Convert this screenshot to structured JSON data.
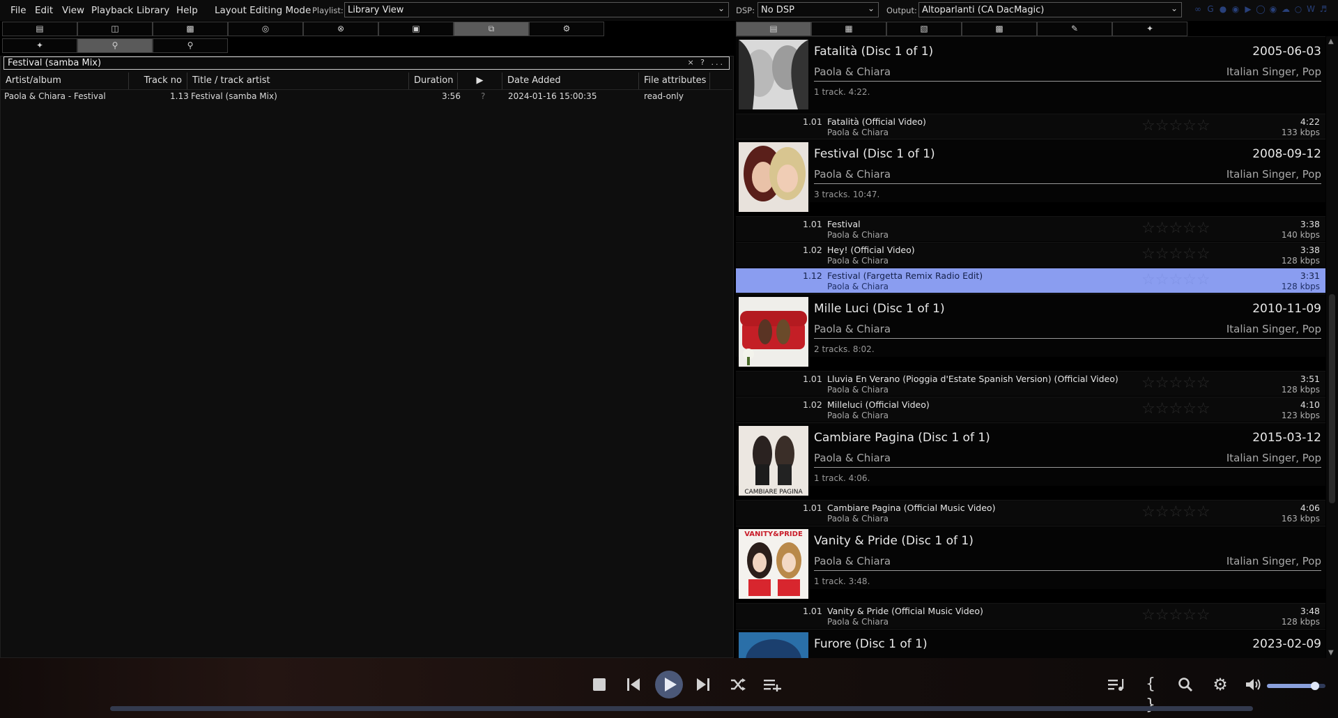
{
  "menu": {
    "items": [
      "File",
      "Edit",
      "View",
      "Playback",
      "Library",
      "Help"
    ],
    "layout_mode": "Layout Editing Mode",
    "playlist_label": "Playlist:",
    "playlist_value": "Library View",
    "dsp_label": "DSP:",
    "dsp_value": "No DSP",
    "output_label": "Output:",
    "output_value": "Altoparlanti (CA DacMagic)"
  },
  "left_tabs": [
    "page-icon",
    "book-icon",
    "card-icon",
    "disc-icon",
    "circle-x-icon",
    "folder-icon",
    "window-icon",
    "gear-icon"
  ],
  "left_tabs_active": 6,
  "sub_tabs": [
    "wand-icon",
    "key-icon",
    "key-outline-icon"
  ],
  "sub_tabs_active": 1,
  "right_tabs": [
    "page-icon",
    "grid-icon",
    "list-icon",
    "card-icon",
    "brush-icon",
    "wand-icon"
  ],
  "right_tabs_active": 0,
  "search": {
    "value": "Festival (samba Mix)",
    "tools": "× ? ..."
  },
  "columns": [
    "Artist/album",
    "Track no",
    "Title / track artist",
    "Duration",
    "▶",
    "Date Added",
    "File attributes"
  ],
  "rows": [
    {
      "artist_album": "Paola & Chiara - Festival",
      "track_no": "1.13",
      "title": "Festival (samba Mix)",
      "duration": "3:56",
      "play": "?",
      "date_added": "2024-01-16 15:00:35",
      "attributes": "read-only"
    }
  ],
  "albums": [
    {
      "title": "Fatalità (Disc 1 of 1)",
      "date": "2005-06-03",
      "artist": "Paola & Chiara",
      "genre": "Italian Singer, Pop",
      "summary": "1 track. 4:22.",
      "tracks": [
        {
          "no": "1.01",
          "title": "Fatalità (Official Video)",
          "artist": "Paola & Chiara",
          "duration": "4:22",
          "bitrate": "133 kbps",
          "selected": false
        }
      ]
    },
    {
      "title": "Festival (Disc 1 of 1)",
      "date": "2008-09-12",
      "artist": "Paola & Chiara",
      "genre": "Italian Singer, Pop",
      "summary": "3 tracks. 10:47.",
      "tracks": [
        {
          "no": "1.01",
          "title": "Festival",
          "artist": "Paola & Chiara",
          "duration": "3:38",
          "bitrate": "140 kbps",
          "selected": false
        },
        {
          "no": "1.02",
          "title": "Hey! (Official Video)",
          "artist": "Paola & Chiara",
          "duration": "3:38",
          "bitrate": "128 kbps",
          "selected": false
        },
        {
          "no": "1.12",
          "title": "Festival (Fargetta Remix Radio Edit)",
          "artist": "Paola & Chiara",
          "duration": "3:31",
          "bitrate": "128 kbps",
          "selected": true
        }
      ]
    },
    {
      "title": "Mille Luci (Disc 1 of 1)",
      "date": "2010-11-09",
      "artist": "Paola & Chiara",
      "genre": "Italian Singer, Pop",
      "summary": "2 tracks. 8:02.",
      "tracks": [
        {
          "no": "1.01",
          "title": "Lluvia En Verano (Pioggia d'Estate Spanish Version) (Official Video)",
          "artist": "Paola & Chiara",
          "duration": "3:51",
          "bitrate": "128 kbps",
          "selected": false
        },
        {
          "no": "1.02",
          "title": "Milleluci (Official Video)",
          "artist": "Paola & Chiara",
          "duration": "4:10",
          "bitrate": "123 kbps",
          "selected": false
        }
      ]
    },
    {
      "title": "Cambiare Pagina (Disc 1 of 1)",
      "date": "2015-03-12",
      "artist": "Paola & Chiara",
      "genre": "Italian Singer, Pop",
      "summary": "1 track. 4:06.",
      "art_text": "CAMBIARE PAGINA",
      "tracks": [
        {
          "no": "1.01",
          "title": "Cambiare Pagina (Official Music Video)",
          "artist": "Paola & Chiara",
          "duration": "4:06",
          "bitrate": "163 kbps",
          "selected": false
        }
      ]
    },
    {
      "title": "Vanity & Pride (Disc 1 of 1)",
      "date": "",
      "artist": "Paola & Chiara",
      "genre": "Italian Singer, Pop",
      "summary": "1 track. 3:48.",
      "art_text": "VANITY&PRIDE",
      "tracks": [
        {
          "no": "1.01",
          "title": "Vanity & Pride (Official Music Video)",
          "artist": "Paola & Chiara",
          "duration": "3:48",
          "bitrate": "128 kbps",
          "selected": false
        }
      ]
    },
    {
      "title": "Furore (Disc 1 of 1)",
      "date": "2023-02-09",
      "artist": "",
      "genre": "",
      "summary": "",
      "tracks": []
    }
  ],
  "player": {
    "buttons": [
      "stop-icon",
      "previous-icon",
      "play-icon",
      "next-icon",
      "shuffle-icon",
      "queue-add-icon"
    ],
    "right_buttons": [
      "playlist-icon",
      "braces-icon",
      "search-icon",
      "gear-icon",
      "volume-icon"
    ],
    "volume": 0.82,
    "progress": 0.0
  },
  "colors": {
    "accent": "#4b5878",
    "selection": "#8a9df0"
  }
}
